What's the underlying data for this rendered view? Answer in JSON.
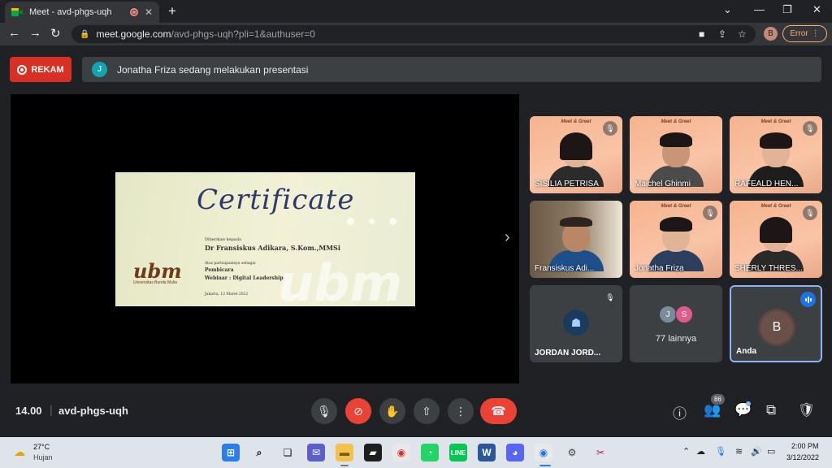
{
  "browser": {
    "tab_title": "Meet - avd-phgs-uqh",
    "new_tab_icon": "+",
    "url_host": "meet.google.com",
    "url_path": "/avd-phgs-uqh?pli=1&authuser=0",
    "profile_initial": "B",
    "error_label": "Error"
  },
  "meet": {
    "record_label": "REKAM",
    "presenter_initial": "J",
    "presenting_text": "Jonatha Friza sedang melakukan presentasi",
    "meeting_time": "14.00",
    "separator": "|",
    "meeting_code": "avd-phgs-uqh",
    "people_count": "86"
  },
  "certificate": {
    "title": "Certificate",
    "given_to_label": "Diberikan kepada",
    "recipient": "Dr Fransiskus Adikara, S.Kom.,MMSi",
    "role_label": "Atas partisipasinya sebagai",
    "role": "Pembicara",
    "event": "Webinar : Digital Leadership",
    "date_line": "Jakarta, 12 Maret 2022",
    "logo": "ubm",
    "logo_sub": "Universitas Bunda Mulia",
    "watermark": "ubm"
  },
  "participants": [
    {
      "name": "SISILIA PETRISA"
    },
    {
      "name": "Maichel Ghinmi"
    },
    {
      "name": "RAFEALD HEN..."
    },
    {
      "name": "Fransiskus Adi..."
    },
    {
      "name": "Jonatha Friza"
    },
    {
      "name": "SHERLY THRES..."
    },
    {
      "name": "JORDAN JORD..."
    },
    {
      "name": "77 lainnya",
      "initials": [
        "J",
        "S"
      ]
    },
    {
      "name": "Anda",
      "initial": "B"
    }
  ],
  "tile_banner": "Meet & Greet",
  "taskbar": {
    "temperature": "27°C",
    "weather": "Hujan",
    "time": "2:00 PM",
    "date": "3/12/2022"
  },
  "colors": {
    "meet_bg": "#202124",
    "record_red": "#d93025",
    "leave_red": "#ea4335",
    "accent_blue": "#1a73e8",
    "tile_dark": "#3c4043"
  }
}
